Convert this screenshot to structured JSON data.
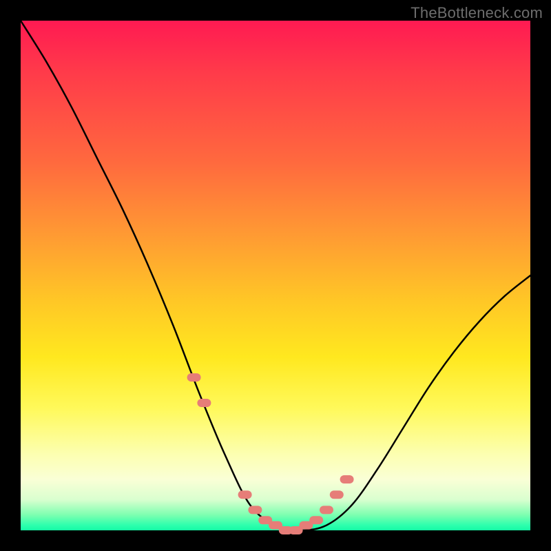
{
  "watermark": "TheBottleneck.com",
  "colors": {
    "frame": "#000000",
    "gradient_top": "#ff1a52",
    "gradient_bottom": "#15fba6",
    "curve": "#000000",
    "points": "#e67d78",
    "watermark": "#6d6d6d"
  },
  "chart_data": {
    "type": "line",
    "title": "",
    "xlabel": "",
    "ylabel": "",
    "xlim": [
      0,
      100
    ],
    "ylim": [
      0,
      100
    ],
    "series": [
      {
        "name": "bottleneck-curve",
        "x": [
          0,
          5,
          10,
          15,
          20,
          25,
          30,
          35,
          40,
          45,
          50,
          55,
          60,
          65,
          70,
          75,
          80,
          85,
          90,
          95,
          100
        ],
        "values": [
          100,
          92,
          83,
          73,
          63,
          52,
          40,
          27,
          15,
          5,
          1,
          0,
          1,
          5,
          12,
          20,
          28,
          35,
          41,
          46,
          50
        ]
      }
    ],
    "scatter_points": {
      "name": "highlight-range",
      "x": [
        34,
        36,
        44,
        46,
        48,
        50,
        52,
        54,
        56,
        58,
        60,
        62,
        64
      ],
      "values": [
        30,
        25,
        7,
        4,
        2,
        1,
        0,
        0,
        1,
        2,
        4,
        7,
        10
      ]
    }
  }
}
